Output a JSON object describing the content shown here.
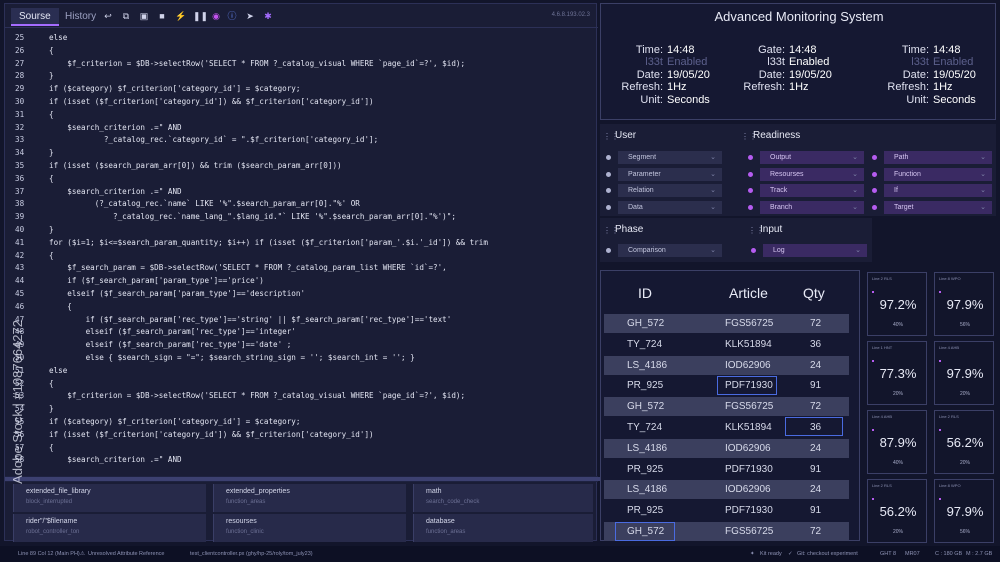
{
  "editor": {
    "tabs": [
      "Sourse",
      "History"
    ],
    "version": "4.6.8.193.02.3",
    "toolbar_icons": [
      "undo-icon",
      "copy-icon",
      "box-icon",
      "stop-icon",
      "run-icon",
      "pause-icon",
      "record-icon",
      "info-icon",
      "cursor-icon",
      "debug-icon"
    ],
    "lines": [
      {
        "n": "25",
        "t": "else"
      },
      {
        "n": "26",
        "t": "{"
      },
      {
        "n": "27",
        "t": "    $f_criterion = $DB->selectRow('SELECT * FROM ?_catalog_visual WHERE `page_id`=?', $id);"
      },
      {
        "n": "28",
        "t": "}"
      },
      {
        "n": "29",
        "t": "if ($category) $f_criterion['category_id'] = $category;"
      },
      {
        "n": "30",
        "t": "if (isset ($f_criterion['category_id']) && $f_criterion['category_id'])"
      },
      {
        "n": "31",
        "t": "{"
      },
      {
        "n": "32",
        "t": "    $search_criterion .=\" AND"
      },
      {
        "n": "33",
        "t": "            ?_catalog_rec.`category_id` = \".$f_criterion['category_id'];"
      },
      {
        "n": "34",
        "t": "}"
      },
      {
        "n": "35",
        "t": "if (isset ($search_param_arr[0]) && trim ($search_param_arr[0]))"
      },
      {
        "n": "36",
        "t": "{"
      },
      {
        "n": "37",
        "t": "    $search_criterion .=\" AND"
      },
      {
        "n": "38",
        "t": "          (?_catalog_rec.`name` LIKE '%\".$search_param_arr[0].\"%' OR"
      },
      {
        "n": "39",
        "t": "              ?_catalog_rec.`name_lang_\".$lang_id.\"` LIKE '%\".$search_param_arr[0].\"%')\";"
      },
      {
        "n": "40",
        "t": "}"
      },
      {
        "n": "41",
        "t": "for ($i=1; $i<=$search_param_quantity; $i++) if (isset ($f_criterion['param_'.$i.'_id']) && trim"
      },
      {
        "n": "42",
        "t": "{"
      },
      {
        "n": "43",
        "t": "    $f_search_param = $DB->selectRow('SELECT * FROM ?_catalog_param_list WHERE `id`=?',"
      },
      {
        "n": "44",
        "t": "    if ($f_search_param['param_type']=='price')"
      },
      {
        "n": "45",
        "t": "    elseif ($f_search_param['param_type']=='description'"
      },
      {
        "n": "46",
        "t": "    {"
      },
      {
        "n": "47",
        "t": "        if ($f_search_param['rec_type']=='string' || $f_search_param['rec_type']=='text'"
      },
      {
        "n": "48",
        "t": "        elseif ($f_search_param['rec_type']=='integer'"
      },
      {
        "n": "49",
        "t": "        elseif ($f_search_param['rec_type']=='date' ;"
      },
      {
        "n": "50",
        "t": "        else { $search_sign = \"=\"; $search_string_sign = ''; $search_int = ''; }"
      },
      {
        "n": "51",
        "t": "else"
      },
      {
        "n": "52",
        "t": "{"
      },
      {
        "n": "53",
        "t": "    $f_criterion = $DB->selectRow('SELECT * FROM ?_catalog_visual WHERE `page_id`=?', $id);"
      },
      {
        "n": "54",
        "t": "}"
      },
      {
        "n": "55",
        "t": "if ($category) $f_criterion['category_id'] = $category;"
      },
      {
        "n": "56",
        "t": "if (isset ($f_criterion['category_id']) && $f_criterion['category_id'])"
      },
      {
        "n": "57",
        "t": "{"
      },
      {
        "n": "58",
        "t": "    $search_criterion .=\" AND"
      }
    ],
    "cards": [
      {
        "title": "extended_file_library",
        "sub": "block_interrupted"
      },
      {
        "title": "extended_properties",
        "sub": "function_areas"
      },
      {
        "title": "math",
        "sub": "search_code_check"
      },
      {
        "title": "rider\"/\"$filename",
        "sub": "robot_controller_ton"
      },
      {
        "title": "resourses",
        "sub": "function_clinic"
      },
      {
        "title": "database",
        "sub": "function_areas"
      }
    ]
  },
  "status_bar": {
    "position": "Line 89 Col 12 (Main PH)",
    "warning": "Unresolved Attribute Reference",
    "path": "test_clientcontroller.px (ghy/hp-25/roly/tom_july23)",
    "kit": "Kit ready",
    "git": "Git: checkout experiment",
    "branch": "GHT 8",
    "mode": "MR07",
    "disk": "C : 180 GB",
    "mem": "M : 2.7 GB"
  },
  "monitor": {
    "title": "Advanced Monitoring System",
    "columns": [
      {
        "rows": [
          {
            "k": "Time:",
            "v": "14:48"
          },
          {
            "k": "l33t",
            "v": "Enabled",
            "dim": true
          },
          {
            "k": "Date:",
            "v": "19/05/20"
          },
          {
            "k": "Refresh:",
            "v": "1Hz"
          },
          {
            "k": "Unit:",
            "v": "Seconds"
          }
        ]
      },
      {
        "rows": [
          {
            "k": "Gate:",
            "v": "14:48"
          },
          {
            "k": "l33t",
            "v": "Enabled"
          },
          {
            "k": "Date:",
            "v": "19/05/20"
          },
          {
            "k": "Refresh:",
            "v": "1Hz"
          },
          {
            "k": "",
            "v": ""
          }
        ]
      },
      {
        "rows": [
          {
            "k": "Time:",
            "v": "14:48"
          },
          {
            "k": "l33t",
            "v": "Enabled",
            "dim": true
          },
          {
            "k": "Date:",
            "v": "19/05/20"
          },
          {
            "k": "Refresh:",
            "v": "1Hz"
          },
          {
            "k": "Unit:",
            "v": "Seconds"
          }
        ]
      }
    ]
  },
  "settings": {
    "user": {
      "title": "User",
      "items": [
        "Segment",
        "Parameter",
        "Relation",
        "Data"
      ]
    },
    "readiness": {
      "title": "Readiness",
      "col1": [
        "Output",
        "Resourses",
        "Track",
        "Branch"
      ],
      "col2": [
        "Path",
        "Function",
        "If",
        "Target"
      ]
    },
    "phase": {
      "title": "Phase",
      "items": [
        "Comparison"
      ]
    },
    "input": {
      "title": "Input",
      "items": [
        "Log"
      ]
    }
  },
  "table": {
    "headers": [
      "ID",
      "Article",
      "Qty"
    ],
    "rows": [
      [
        "GH_572",
        "FGS56725",
        "72"
      ],
      [
        "TY_724",
        "KLK51894",
        "36"
      ],
      [
        "LS_4186",
        "IOD62906",
        "24"
      ],
      [
        "PR_925",
        "PDF71930",
        "91"
      ],
      [
        "GH_572",
        "FGS56725",
        "72"
      ],
      [
        "TY_724",
        "KLK51894",
        "36"
      ],
      [
        "LS_4186",
        "IOD62906",
        "24"
      ],
      [
        "PR_925",
        "PDF71930",
        "91"
      ],
      [
        "LS_4186",
        "IOD62906",
        "24"
      ],
      [
        "PR_925",
        "PDF71930",
        "91"
      ],
      [
        "GH_572",
        "FGS56725",
        "72"
      ]
    ]
  },
  "tiles": [
    {
      "label": "Line 2 RLS",
      "pct": "97.2%",
      "sub": "40%"
    },
    {
      "label": "Line 8 WPO",
      "pct": "97.9%",
      "sub": "56%"
    },
    {
      "label": "Line 1 HNT",
      "pct": "77.3%",
      "sub": "20%"
    },
    {
      "label": "Line 4 AHB",
      "pct": "97.9%",
      "sub": "20%"
    },
    {
      "label": "Line 4 AHB",
      "pct": "87.9%",
      "sub": "40%"
    },
    {
      "label": "Line 2 RLS",
      "pct": "56.2%",
      "sub": "20%"
    },
    {
      "label": "Line 2 RLS",
      "pct": "56.2%",
      "sub": "20%"
    },
    {
      "label": "Line 8 WPO",
      "pct": "97.9%",
      "sub": "56%"
    }
  ],
  "watermark": "Adobe Stock | #1087664272",
  "colors": {
    "accent": "#a56cff",
    "highlight": "#4a6be0",
    "panel": "#151832",
    "background": "#12152b"
  }
}
